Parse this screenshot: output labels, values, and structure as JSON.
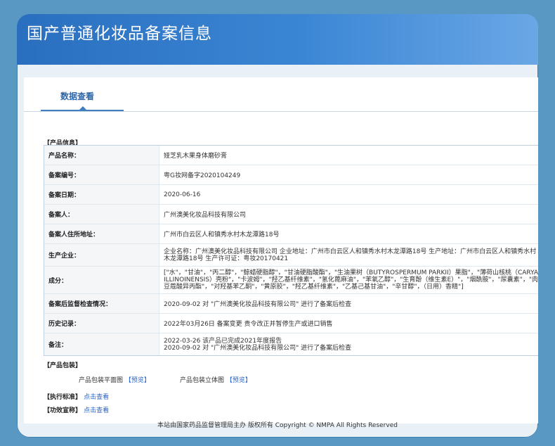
{
  "header": {
    "title": "国产普通化妆品备案信息"
  },
  "tabs": {
    "active": "数据查看"
  },
  "product_info": {
    "section_title": "【产品信息】",
    "rows": [
      {
        "label": "产品名称：",
        "value": "娅芝乳木果身体磨砂膏"
      },
      {
        "label": "备案编号：",
        "value": "粤G妆网备字2020104249"
      },
      {
        "label": "备案日期：",
        "value": "2020-06-16"
      },
      {
        "label": "备案人：",
        "value": "广州澳美化妆品科技有限公司"
      },
      {
        "label": "备案人住所地址：",
        "value": "广州市白云区人和镇秀水村木龙潭路18号"
      },
      {
        "label": "生产企业：",
        "value": "企业名称：广州澳美化妆品科技有限公司 企业地址：广州市白云区人和镇秀水村木龙潭路18号 生产地址：广州市白云区人和镇秀水村木龙潭路18号 生产许可证：粤妆20170421"
      },
      {
        "label": "成分：",
        "value": "[\"水\"，\"甘油\"，\"丙二醇\"，\"鲸蜡硬脂醇\"，\"甘油硬脂酸酯\"，\"生油果树（BUTYROSPERMUM PARKII）果脂\"，\"薄荷山核桃（CARYA ILLINOINENSIS）壳粉\"，\"卡波姆\"，\"羟乙基纤维素\"，\"氢化蓖麻油\"，\"苯氧乙醇\"，\"生育酚（维生素E）\"，\"烟酰胺\"，\"尿囊素\"，\"肉豆蔻酸异丙酯\"，\"对羟基苯乙酮\"，\"黄原胶\"，\"羟乙基纤维素\"，\"乙基己基甘油\"，\"辛甘醇\"，（日用）香精\"]"
      },
      {
        "label": "备案后监督检查情况：",
        "value": "2020-09-02 对 \"广州澳美化妆品科技有限公司\" 进行了备案后检查"
      },
      {
        "label": "历史记录：",
        "value": "2022年03月26日 备案变更 责令改正并暂停生产或进口销售"
      },
      {
        "label": "备注：",
        "value": "2022-03-26 该产品已完成2021年度报告\n2020-09-02 对 \"广州澳美化妆品科技有限公司\" 进行了备案后检查"
      }
    ]
  },
  "packaging": {
    "section_title": "【产品包装】",
    "flat_label": "产品包装平面图",
    "flat_link": "预览",
    "solid_label": "产品包装立体图",
    "solid_link": "预览"
  },
  "standard": {
    "label": "【执行标准】",
    "link": "点击查看"
  },
  "efficacy": {
    "label": "【功效宣称】",
    "link": "点击查看"
  },
  "footer": {
    "text": "本站由国家药品监督管理局主办 版权所有 Copyright © NMPA All Rights Reserved"
  }
}
